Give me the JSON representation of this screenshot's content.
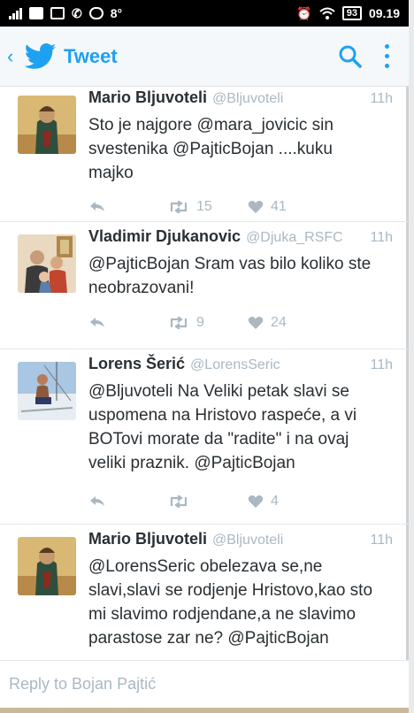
{
  "status_bar": {
    "temperature": "8°",
    "battery": "93",
    "time": "09.19",
    "icons": [
      "signal-bars-icon",
      "facebook-icon",
      "gallery-icon",
      "viber-icon",
      "chat-icon",
      "alarm-icon",
      "wifi-icon",
      "battery-icon"
    ]
  },
  "app_bar": {
    "title": "Tweet",
    "icons": [
      "back-arrow-icon",
      "twitter-bird-icon",
      "search-icon",
      "more-vertical-icon"
    ],
    "accent_color": "#1da1f2"
  },
  "tweets": [
    {
      "name": "Mario Bljuvoteli",
      "handle": "@Bljuvoteli",
      "time": "11h",
      "lines": [
        "Sto je najgore @mara_jovicic sin",
        "svestenika @PajticBojan ....kuku",
        "majko"
      ],
      "retweets": "15",
      "likes": "41"
    },
    {
      "name": "Vladimir Djukanovic",
      "handle": "@Djuka_RSFC",
      "time": "11h",
      "lines": [
        "@PajticBojan Sram vas bilo koliko ste",
        "neobrazovani!"
      ],
      "retweets": "9",
      "likes": "24"
    },
    {
      "name": "Lorens Šerić",
      "handle": "@LorensSeric",
      "time": "11h",
      "lines": [
        "@Bljuvoteli Na Veliki petak slavi se",
        "uspomena na Hristovo raspeće, a vi",
        "BOTovi morate da \"radite\" i na ovaj",
        "veliki praznik.  @PajticBojan"
      ],
      "retweets": "",
      "likes": "4"
    },
    {
      "name": "Mario Bljuvoteli",
      "handle": "@Bljuvoteli",
      "time": "11h",
      "lines": [
        "@LorensSeric obelezava se,ne",
        "slavi,slavi se rodjenje Hristovo,kao sto",
        "mi slavimo rodjendane,a ne slavimo",
        "parastose zar ne? @PajticBojan"
      ],
      "retweets": "",
      "likes": ""
    }
  ],
  "reply": {
    "placeholder": "Reply to Bojan Pajtić"
  }
}
